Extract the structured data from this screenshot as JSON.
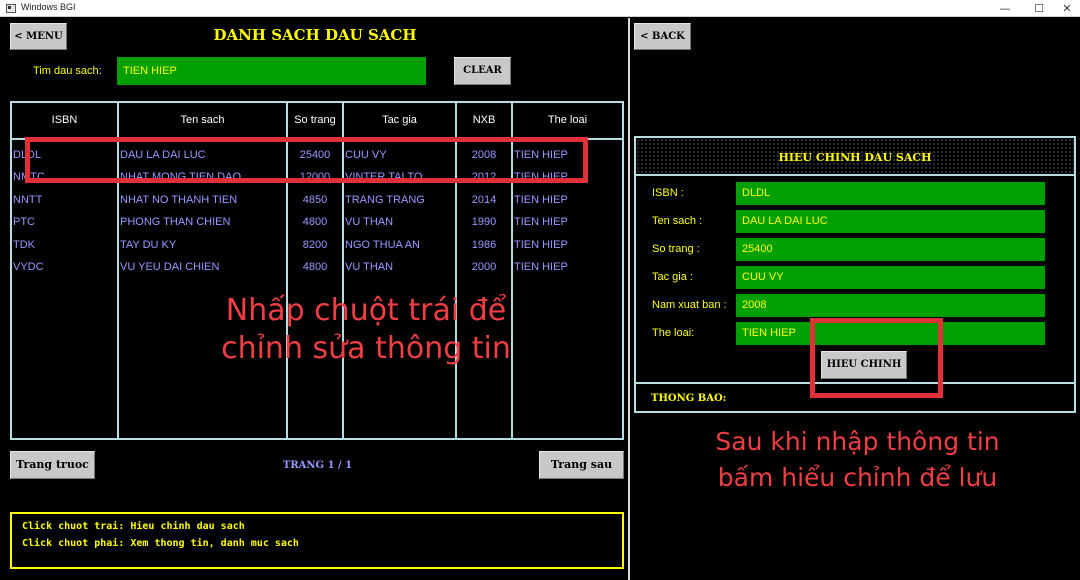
{
  "window": {
    "title": "Windows BGI",
    "minimize": "—",
    "maximize": "☐",
    "close": "✕"
  },
  "left": {
    "menu_button": "< MENU",
    "title": "DANH SACH DAU SACH",
    "search_label": "Tim dau sach:",
    "search_value": "TIEN HIEP",
    "clear_button": "CLEAR",
    "table": {
      "headers": [
        "ISBN",
        "Ten sach",
        "So trang",
        "Tac gia",
        "NXB",
        "The loai"
      ],
      "rows": [
        [
          "DLDL",
          "DAU LA DAI LUC",
          "25400",
          "CUU VY",
          "2008",
          "TIEN HIEP"
        ],
        [
          "NMTC",
          "NHAT MONG TIEN DAO",
          "12000",
          "VINTER TAI TO",
          "2012",
          "TIEN HIEP"
        ],
        [
          "NNTT",
          "NHAT NO THANH TIEN",
          "4850",
          "TRANG TRANG",
          "2014",
          "TIEN HIEP"
        ],
        [
          "PTC",
          "PHONG THAN CHIEN",
          "4800",
          "VU THAN",
          "1990",
          "TIEN HIEP"
        ],
        [
          "TDK",
          "TAY DU KY",
          "8200",
          "NGO THUA AN",
          "1986",
          "TIEN HIEP"
        ],
        [
          "VYDC",
          "VU YEU DAI CHIEN",
          "4800",
          "VU THAN",
          "2000",
          "TIEN HIEP"
        ]
      ]
    },
    "prev_button": "Trang truoc",
    "page_indicator": "TRANG 1 / 1",
    "next_button": "Trang sau",
    "help": [
      "Click chuot trai: Hieu chinh dau sach",
      "Click chuot phai: Xem thong tin, danh muc sach"
    ]
  },
  "right": {
    "back_button": "< BACK",
    "form_title": "HIEU CHINH DAU SACH",
    "fields": [
      {
        "label": "ISBN :",
        "value": "DLDL"
      },
      {
        "label": "Ten sach :",
        "value": "DAU LA DAI LUC"
      },
      {
        "label": "So trang :",
        "value": "25400"
      },
      {
        "label": "Tac gia :",
        "value": "CUU VY"
      },
      {
        "label": "Nam xuat ban :",
        "value": "2008"
      },
      {
        "label": "The loai:",
        "value": "TIEN HIEP"
      }
    ],
    "submit_button": "HIEU CHINH",
    "status_label": "THONG BAO:"
  },
  "annotations": {
    "left_note": [
      "Nhấp chuột trái để",
      "chỉnh sửa thông tin"
    ],
    "right_note": [
      "Sau khi nhập thông tin",
      "bấm hiểu chỉnh để lưu"
    ],
    "color": "#e03038"
  },
  "colors": {
    "background": "#000000",
    "field": "#00a000",
    "heading": "#ffff00",
    "table_text": "#9999ff",
    "border": "#b8dde0"
  }
}
